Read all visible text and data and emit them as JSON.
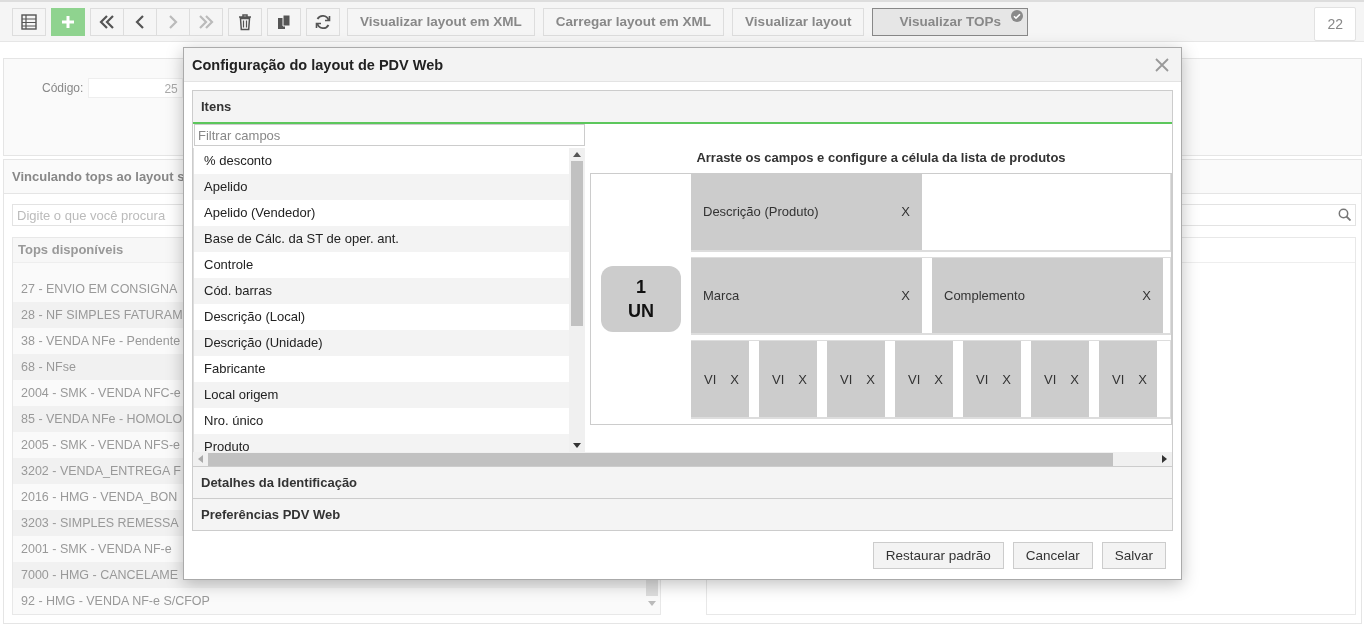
{
  "toolbar": {
    "icon_buttons": [
      {
        "kind": "list",
        "disabled": false
      },
      {
        "kind": "add",
        "disabled": false
      },
      {
        "kind": "first",
        "disabled": false
      },
      {
        "kind": "prev",
        "disabled": false
      },
      {
        "kind": "next",
        "disabled": true
      },
      {
        "kind": "last",
        "disabled": true
      },
      {
        "kind": "delete",
        "disabled": false
      },
      {
        "kind": "copy",
        "disabled": false
      },
      {
        "kind": "refresh",
        "disabled": false
      }
    ],
    "text_buttons": [
      {
        "label": "Visualizar layout em XML",
        "selected": false
      },
      {
        "label": "Carregar layout em XML",
        "selected": false
      },
      {
        "label": "Visualizar layout",
        "selected": false
      },
      {
        "label": "Visualizar TOPs",
        "selected": true
      }
    ],
    "counter": "22"
  },
  "form": {
    "code_label": "Código:",
    "code_value": "25"
  },
  "section_title": "Vinculando tops ao layout s",
  "search": {
    "placeholder": "Digite o que você procura"
  },
  "available_tops": {
    "header": "Tops disponíveis",
    "rows": [
      "27 - ENVIO EM CONSIGNA",
      "28 - NF SIMPLES FATURAM",
      "38 - VENDA NFe - Pendente",
      "68 - NFse",
      "2004 - SMK - VENDA NFC-e",
      "85 - VENDA NFe - HOMOLO",
      "2005 - SMK - VENDA NFS-e",
      "3202 - VENDA_ENTREGA F",
      "2016 - HMG - VENDA_BON",
      "3203 - SIMPLES REMESSA",
      "2001 - SMK - VENDA NF-e",
      "7000 - HMG - CANCELAME",
      "92 - HMG - VENDA NF-e S/CFOP"
    ]
  },
  "modal": {
    "title": "Configuração do layout de PDV Web",
    "sections": [
      {
        "title": "Itens",
        "expanded": true
      },
      {
        "title": "Detalhes da Identificação",
        "expanded": false
      },
      {
        "title": "Preferências PDV Web",
        "expanded": false
      }
    ],
    "filter": {
      "placeholder": "Filtrar campos"
    },
    "fields": [
      "% desconto",
      "Apelido",
      "Apelido (Vendedor)",
      "Base de Cálc. da ST de oper. ant.",
      "Controle",
      "Cód. barras",
      "Descrição (Local)",
      "Descrição (Unidade)",
      "Fabricante",
      "Local origem",
      "Nro. único",
      "Produto"
    ],
    "designer": {
      "instruction": "Arraste os campos e configure a célula da lista de produtos",
      "quantity": "1",
      "unit": "UN",
      "lines": [
        {
          "kind": "wide",
          "items": [
            {
              "label": "Descrição (Produto)",
              "remove": "X"
            }
          ]
        },
        {
          "kind": "wide",
          "items": [
            {
              "label": "Marca",
              "remove": "X"
            },
            {
              "label": "Complemento",
              "remove": "X"
            }
          ]
        },
        {
          "kind": "narrow",
          "items": [
            {
              "label": "VI",
              "remove": "X"
            },
            {
              "label": "VI",
              "remove": "X"
            },
            {
              "label": "VI",
              "remove": "X"
            },
            {
              "label": "VI",
              "remove": "X"
            },
            {
              "label": "VI",
              "remove": "X"
            },
            {
              "label": "VI",
              "remove": "X"
            },
            {
              "label": "VI",
              "remove": "X"
            }
          ]
        }
      ]
    },
    "buttons": [
      "Restaurar padrão",
      "Cancelar",
      "Salvar"
    ]
  }
}
